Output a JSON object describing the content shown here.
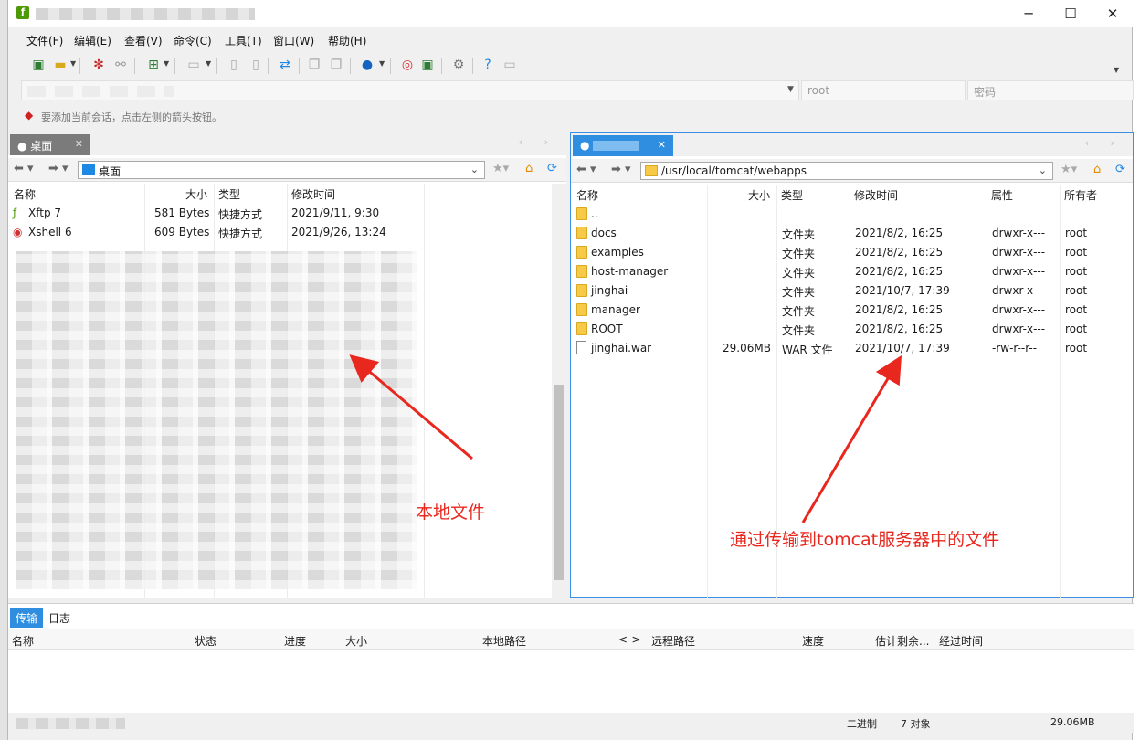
{
  "window": {
    "title_blurred": true
  },
  "menu": [
    "文件(F)",
    "编辑(E)",
    "查看(V)",
    "命令(C)",
    "工具(T)",
    "窗口(W)",
    "帮助(H)"
  ],
  "address": {
    "username_placeholder": "root",
    "password_placeholder": "密码"
  },
  "hint": "要添加当前会话，点击左侧的箭头按钮。",
  "left_pane": {
    "tab_label": "桌面",
    "path": "桌面",
    "columns": [
      "名称",
      "大小",
      "类型",
      "修改时间"
    ],
    "rows": [
      {
        "name": "Xftp 7",
        "size": "581 Bytes",
        "type": "快捷方式",
        "modified": "2021/9/11, 9:30"
      },
      {
        "name": "Xshell 6",
        "size": "609 Bytes",
        "type": "快捷方式",
        "modified": "2021/9/26, 13:24"
      }
    ]
  },
  "right_pane": {
    "path": "/usr/local/tomcat/webapps",
    "columns": [
      "名称",
      "大小",
      "类型",
      "修改时间",
      "属性",
      "所有者"
    ],
    "rows": [
      {
        "name": "..",
        "size": "",
        "type": "",
        "modified": "",
        "attr": "",
        "owner": "",
        "kind": "folder"
      },
      {
        "name": "docs",
        "size": "",
        "type": "文件夹",
        "modified": "2021/8/2, 16:25",
        "attr": "drwxr-x---",
        "owner": "root",
        "kind": "folder"
      },
      {
        "name": "examples",
        "size": "",
        "type": "文件夹",
        "modified": "2021/8/2, 16:25",
        "attr": "drwxr-x---",
        "owner": "root",
        "kind": "folder"
      },
      {
        "name": "host-manager",
        "size": "",
        "type": "文件夹",
        "modified": "2021/8/2, 16:25",
        "attr": "drwxr-x---",
        "owner": "root",
        "kind": "folder"
      },
      {
        "name": "jinghai",
        "size": "",
        "type": "文件夹",
        "modified": "2021/10/7, 17:39",
        "attr": "drwxr-x---",
        "owner": "root",
        "kind": "folder"
      },
      {
        "name": "manager",
        "size": "",
        "type": "文件夹",
        "modified": "2021/8/2, 16:25",
        "attr": "drwxr-x---",
        "owner": "root",
        "kind": "folder"
      },
      {
        "name": "ROOT",
        "size": "",
        "type": "文件夹",
        "modified": "2021/8/2, 16:25",
        "attr": "drwxr-x---",
        "owner": "root",
        "kind": "folder"
      },
      {
        "name": "jinghai.war",
        "size": "29.06MB",
        "type": "WAR 文件",
        "modified": "2021/10/7, 17:39",
        "attr": "-rw-r--r--",
        "owner": "root",
        "kind": "file"
      }
    ]
  },
  "annotations": {
    "left": "本地文件",
    "right": "通过传输到tomcat服务器中的文件",
    "color": "#e8281e"
  },
  "transfer": {
    "tabs": [
      "传输",
      "日志"
    ],
    "columns": [
      "名称",
      "状态",
      "进度",
      "大小",
      "本地路径",
      "<->",
      "远程路径",
      "速度",
      "估计剩余...",
      "经过时间"
    ]
  },
  "status": {
    "mode": "二进制",
    "objects": "7 对象",
    "size": "29.06MB"
  }
}
